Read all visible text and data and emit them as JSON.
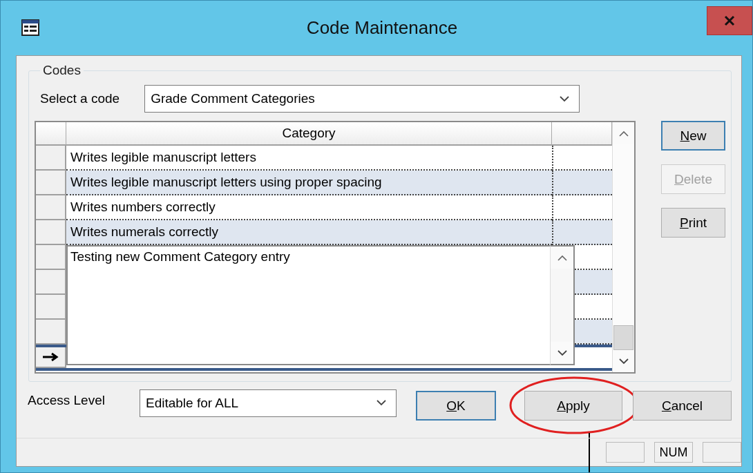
{
  "window": {
    "title": "Code Maintenance"
  },
  "codes_group": {
    "legend": "Codes",
    "select_label": "Select a code",
    "select_value": "Grade Comment Categories"
  },
  "table": {
    "columns": [
      "Category"
    ],
    "rows": [
      {
        "category": "Writes legible manuscript letters"
      },
      {
        "category": "Writes legible manuscript letters using proper spacing"
      },
      {
        "category": "Writes numbers correctly"
      },
      {
        "category": "Writes numerals correctly"
      }
    ],
    "new_row": {
      "current": true,
      "value": "Testing new Comment Category entry"
    }
  },
  "side_buttons": [
    {
      "label": "New",
      "disabled": false,
      "focused": true
    },
    {
      "label": "Delete",
      "disabled": true,
      "focused": false
    },
    {
      "label": "Print",
      "disabled": false,
      "focused": false
    }
  ],
  "access": {
    "label": "Access Level",
    "value": "Editable for ALL"
  },
  "buttons": [
    {
      "label": "OK",
      "focused": true,
      "highlighted": false
    },
    {
      "label": "Apply",
      "focused": false,
      "highlighted": true
    },
    {
      "label": "Cancel",
      "focused": false,
      "highlighted": false
    }
  ],
  "status_bar": {
    "indicator": "NUM"
  }
}
